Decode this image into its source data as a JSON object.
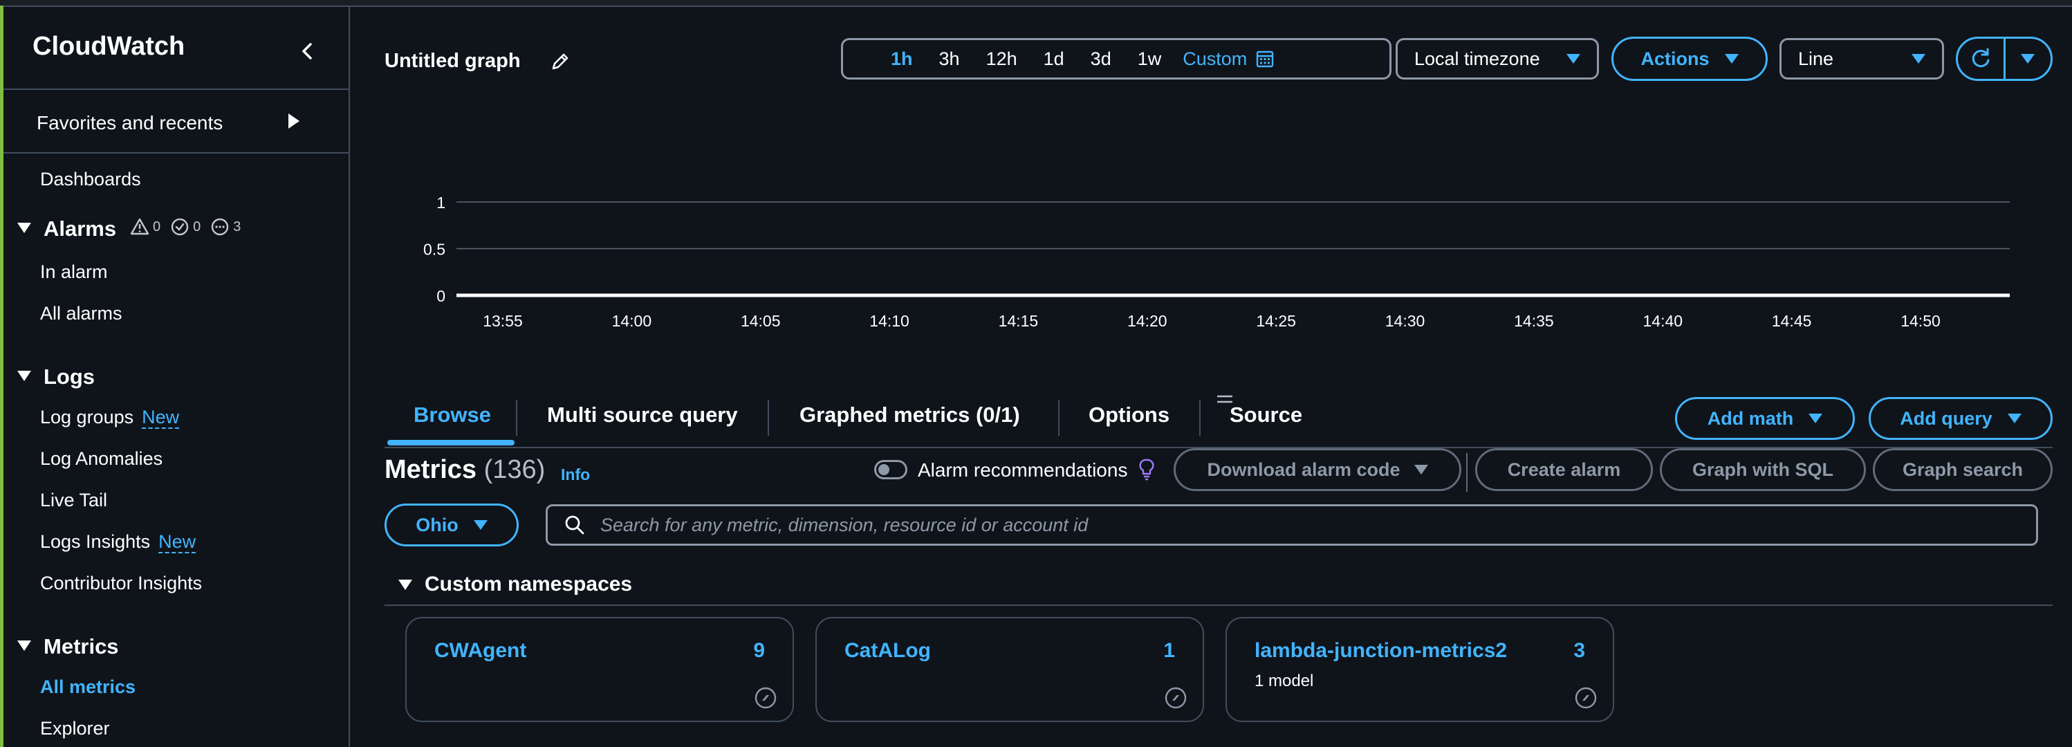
{
  "sidebar": {
    "title": "CloudWatch",
    "favorites_label": "Favorites and recents",
    "dashboards": "Dashboards",
    "alarms": {
      "label": "Alarms",
      "in_alarm_count": "0",
      "ok_count": "0",
      "insufficient_count": "3",
      "in_alarm": "In alarm",
      "all_alarms": "All alarms"
    },
    "logs": {
      "label": "Logs",
      "log_groups": "Log groups",
      "log_groups_badge": "New",
      "log_anomalies": "Log Anomalies",
      "live_tail": "Live Tail",
      "logs_insights": "Logs Insights",
      "logs_insights_badge": "New",
      "contributor_insights": "Contributor Insights"
    },
    "metrics": {
      "label": "Metrics",
      "all_metrics": "All metrics",
      "explorer": "Explorer"
    }
  },
  "header": {
    "graph_title": "Untitled graph",
    "time_ranges": [
      "1h",
      "3h",
      "12h",
      "1d",
      "3d",
      "1w"
    ],
    "active_range": "1h",
    "custom_label": "Custom",
    "timezone": "Local timezone",
    "actions_label": "Actions",
    "graph_type": "Line"
  },
  "chart_data": {
    "type": "line",
    "x": [
      "13:55",
      "14:00",
      "14:05",
      "14:10",
      "14:15",
      "14:20",
      "14:25",
      "14:30",
      "14:35",
      "14:40",
      "14:45",
      "14:50"
    ],
    "y_ticks": [
      "1",
      "0.5",
      "0"
    ],
    "ylim": [
      0,
      1
    ],
    "series": [
      {
        "values": [
          0,
          0,
          0,
          0,
          0,
          0,
          0,
          0,
          0,
          0,
          0,
          0
        ]
      }
    ],
    "grid": true
  },
  "tabs": {
    "items": [
      "Browse",
      "Multi source query",
      "Graphed metrics (0/1)",
      "Options",
      "Source"
    ],
    "active": "Browse",
    "add_math": "Add math",
    "add_query": "Add query"
  },
  "metrics": {
    "title": "Metrics",
    "count": "(136)",
    "info": "Info",
    "alarm_recommendations": "Alarm recommendations",
    "download_alarm_code": "Download alarm code",
    "create_alarm": "Create alarm",
    "graph_with_sql": "Graph with SQL",
    "graph_search": "Graph search",
    "region": "Ohio",
    "search_placeholder": "Search for any metric, dimension, resource id or account id"
  },
  "namespaces": {
    "header": "Custom namespaces",
    "cards": [
      {
        "name": "CWAgent",
        "count": "9",
        "sub": ""
      },
      {
        "name": "CatALog",
        "count": "1",
        "sub": ""
      },
      {
        "name": "lambda-junction-metrics2",
        "count": "3",
        "sub": "1 model"
      }
    ]
  },
  "colors": {
    "background": "#0f141a",
    "accent": "#42b4ff",
    "border": "#8d99a8",
    "disabled": "#5f6b7a"
  }
}
